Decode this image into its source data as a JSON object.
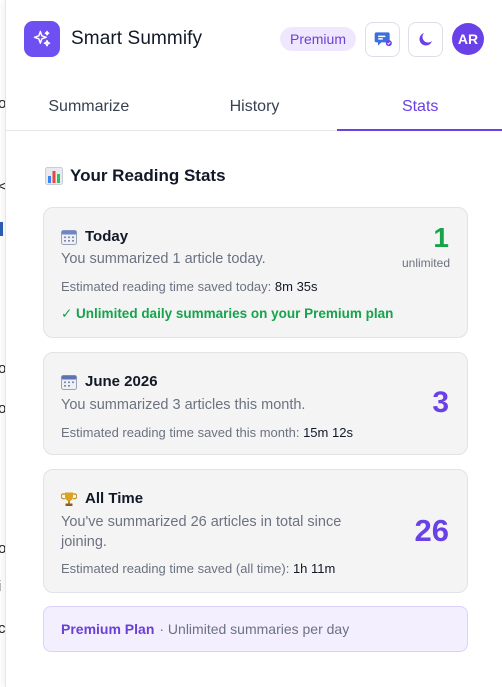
{
  "app": {
    "title": "Smart Summify",
    "badge": "Premium",
    "avatar_initials": "AR",
    "accent_color": "#6a40e8"
  },
  "background_peek": [
    "o",
    "<",
    "r",
    "o",
    "o",
    "o",
    "i",
    "c"
  ],
  "tabs": [
    {
      "label": "Summarize",
      "active": false
    },
    {
      "label": "History",
      "active": false
    },
    {
      "label": "Stats",
      "active": true
    }
  ],
  "stats": {
    "section_title": "Your Reading Stats",
    "section_icon": "bar-chart-icon",
    "today": {
      "title": "Today",
      "icon": "calendar-icon",
      "description": "You summarized 1 article today.",
      "meta_label": "Estimated reading time saved today:",
      "meta_value": "8m 35s",
      "count": "1",
      "count_color": "#16a34a",
      "count_label": "unlimited",
      "note": "✓ Unlimited daily summaries on your Premium plan"
    },
    "month": {
      "title": "June 2026",
      "icon": "calendar-icon",
      "description": "You summarized 3 articles this month.",
      "meta_label": "Estimated reading time saved this month:",
      "meta_value": "15m 12s",
      "count": "3",
      "count_color": "#6a40e8"
    },
    "all_time": {
      "title": "All Time",
      "icon": "trophy-icon",
      "description": "You've summarized 26 articles in total since joining.",
      "meta_label": "Estimated reading time saved (all time):",
      "meta_value": "1h 11m",
      "count": "26",
      "count_color": "#6a40e8"
    }
  },
  "plan": {
    "name": "Premium Plan",
    "description": "· Unlimited summaries per day"
  }
}
